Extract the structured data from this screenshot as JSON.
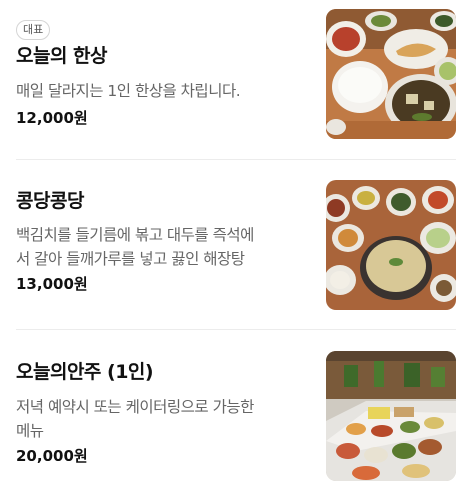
{
  "menu": {
    "items": [
      {
        "badge": "대표",
        "name": "오늘의 한상",
        "description": "매일 달라지는 1인 한상을 차립니다.",
        "price": "12,000원",
        "image": "korean-set-meal-photo"
      },
      {
        "name": "콩당콩당",
        "description_line1": "백김치를 들기름에 볶고 대두를 즉석에",
        "description_line2": "서 갈아 들깨가루를 넣고 끓인 해장탕",
        "price": "13,000원",
        "image": "soybean-soup-photo"
      },
      {
        "name": "오늘의안주 (1인)",
        "description_line1": "저녁 예약시 또는 케이터링으로 가능한",
        "description_line2": "메뉴",
        "price": "20,000원",
        "image": "catering-table-photo"
      }
    ]
  }
}
